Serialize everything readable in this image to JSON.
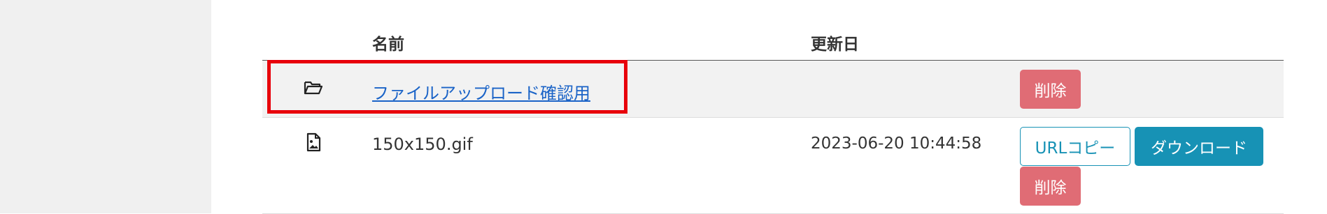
{
  "table": {
    "headers": {
      "icon": "",
      "name": "名前",
      "updated": "更新日",
      "actions": ""
    },
    "rows": [
      {
        "type": "folder",
        "icon": "folder-open-icon",
        "name": "ファイルアップロード確認用",
        "updated": "",
        "actions": {
          "delete": "削除"
        }
      },
      {
        "type": "file",
        "icon": "image-file-icon",
        "name": "150x150.gif",
        "updated": "2023-06-20 10:44:58",
        "actions": {
          "url_copy": "URLコピー",
          "download": "ダウンロード",
          "delete": "削除"
        }
      }
    ]
  },
  "colors": {
    "sidebar_bg": "#f0f0f0",
    "folder_row_bg": "#f2f2f2",
    "link": "#1a63c7",
    "delete_button": "#e06c75",
    "primary_button": "#1792b5",
    "highlight_box": "#e8000b"
  }
}
